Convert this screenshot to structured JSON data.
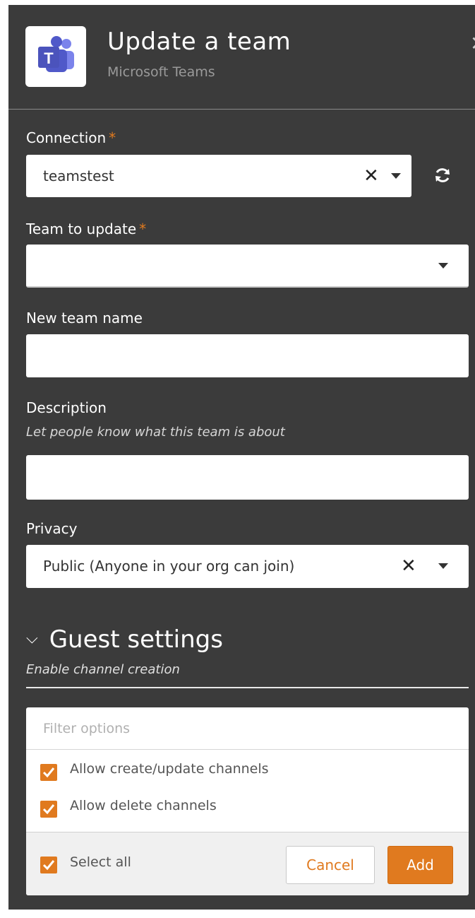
{
  "header": {
    "app_icon": "microsoft-teams-logo",
    "title": "Update a team",
    "subtitle": "Microsoft Teams",
    "close_icon": "close-icon"
  },
  "form": {
    "connection": {
      "label": "Connection",
      "required_mark": "*",
      "value": "teamstest",
      "refresh_icon": "refresh-icon"
    },
    "team_to_update": {
      "label": "Team to update",
      "required_mark": "*",
      "value": ""
    },
    "new_team_name": {
      "label": "New team name",
      "value": ""
    },
    "description": {
      "label": "Description",
      "hint": "Let people know what this team is about",
      "value": ""
    },
    "privacy": {
      "label": "Privacy",
      "value": "Public (Anyone in your org can join)"
    }
  },
  "guest_settings": {
    "title": "Guest settings",
    "subtitle": "Enable channel creation",
    "filter_placeholder": "Filter options",
    "options": [
      {
        "label": "Allow create/update channels",
        "checked": true
      },
      {
        "label": "Allow delete channels",
        "checked": true
      }
    ],
    "select_all": {
      "label": "Select all",
      "checked": true
    },
    "cancel_label": "Cancel",
    "add_label": "Add"
  },
  "colors": {
    "panel_bg": "#3b3b3b",
    "accent": "#e07a1f",
    "field_bg": "#ffffff"
  }
}
